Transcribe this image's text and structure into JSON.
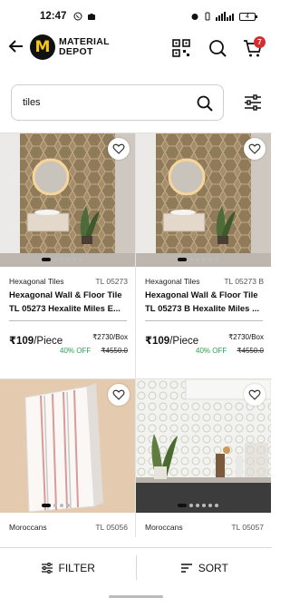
{
  "status_bar": {
    "time": "12:47",
    "battery": "4"
  },
  "header": {
    "logo_letter": "M",
    "logo_line1": "MATERIAL",
    "logo_line2": "DEPOT",
    "cart_count": "7"
  },
  "search": {
    "value": "tiles"
  },
  "products": [
    {
      "category": "Hexagonal Tiles",
      "code": "TL 05273",
      "title": "Hexagonal Wall & Floor Tile TL 05273 Hexalite Miles E...",
      "price": "₹109",
      "unit": "/Piece",
      "box_price": "₹2730/Box",
      "discount": "40% OFF",
      "mrp": "₹4550.0"
    },
    {
      "category": "Hexagonal Tiles",
      "code": "TL 05273 B",
      "title": "Hexagonal Wall & Floor Tile TL 05273 B Hexalite Miles ...",
      "price": "₹109",
      "unit": "/Piece",
      "box_price": "₹2730/Box",
      "discount": "40% OFF",
      "mrp": "₹4550.0"
    },
    {
      "category": "Moroccans",
      "code": "TL 05056"
    },
    {
      "category": "Moroccans",
      "code": "TL 05057"
    }
  ],
  "bottom_bar": {
    "filter_label": "FILTER",
    "sort_label": "SORT"
  },
  "colors": {
    "discount_green": "#2e9e4f",
    "cart_badge_red": "#d32f2f",
    "logo_yellow": "#f5c518"
  }
}
